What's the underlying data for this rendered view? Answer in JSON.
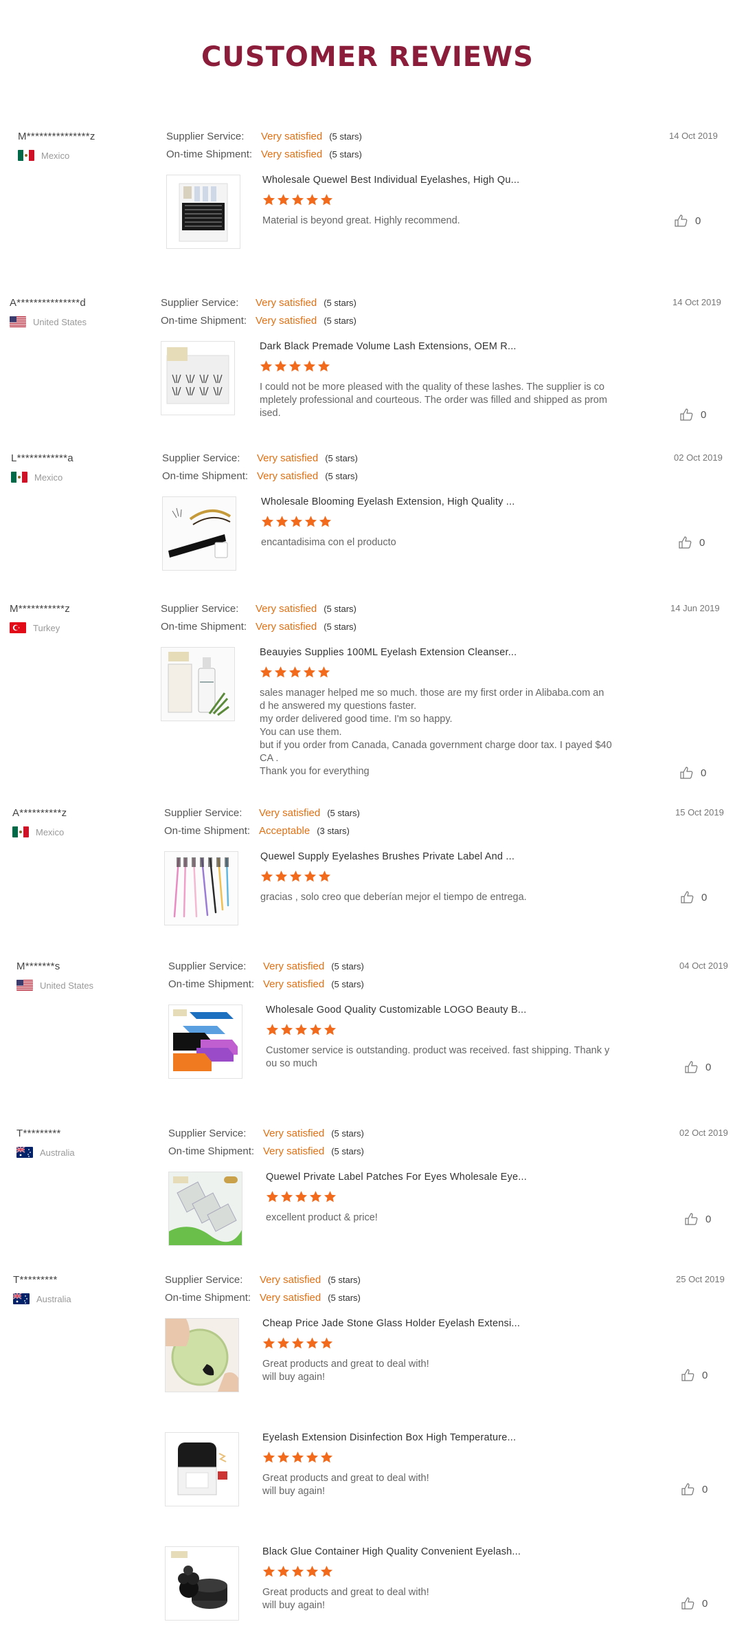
{
  "page_title": "CUSTOMER REVIEWS",
  "labels": {
    "supplier_service": "Supplier Service:",
    "ontime_shipment": "On-time Shipment:"
  },
  "reviews": [
    {
      "buyer": "M***************z",
      "country": "Mexico",
      "flag": "mexico-flag-icon",
      "supplier_rating": "Very satisfied",
      "supplier_stars": "(5 stars)",
      "shipment_rating": "Very satisfied",
      "shipment_stars": "(5 stars)",
      "date": "14 Oct 2019",
      "products": [
        {
          "title": "Wholesale Quewel Best Individual Eyelashes, High Qu...",
          "stars": 5,
          "comment": "Material is beyond great. Highly recommend.",
          "likes": "0",
          "thumb": "lash-trays-icon"
        }
      ]
    },
    {
      "buyer": "A***************d",
      "country": "United States",
      "flag": "usa-flag-icon",
      "supplier_rating": "Very satisfied",
      "supplier_stars": "(5 stars)",
      "shipment_rating": "Very satisfied",
      "shipment_stars": "(5 stars)",
      "date": "14 Oct 2019",
      "products": [
        {
          "title": "Dark Black Premade Volume Lash Extensions, OEM R...",
          "stars": 5,
          "comment": "I could not be more pleased with the quality of these lashes.  The supplier is co\nmpletely professional and courteous. The order was filled and shipped as prom\nised.",
          "likes": "0",
          "thumb": "premade-fans-icon"
        }
      ]
    },
    {
      "buyer": "L************a",
      "country": "Mexico",
      "flag": "mexico-flag-icon",
      "supplier_rating": "Very satisfied",
      "supplier_stars": "(5 stars)",
      "shipment_rating": "Very satisfied",
      "shipment_stars": "(5 stars)",
      "date": "02 Oct 2019",
      "products": [
        {
          "title": "Wholesale Blooming Eyelash Extension, High Quality ...",
          "stars": 5,
          "comment": "encantadisima con el producto",
          "likes": "0",
          "thumb": "blooming-lash-icon"
        }
      ]
    },
    {
      "buyer": "M***********z",
      "country": "Turkey",
      "flag": "turkey-flag-icon",
      "supplier_rating": "Very satisfied",
      "supplier_stars": "(5 stars)",
      "shipment_rating": "Very satisfied",
      "shipment_stars": "(5 stars)",
      "date": "14 Jun 2019",
      "products": [
        {
          "title": "Beauyies Supplies 100ML Eyelash Extension Cleanser...",
          "stars": 5,
          "comment": "sales manager helped me so much. those are my first order in Alibaba.com an\nd he answered my questions faster.\nmy order delivered good time. I'm so happy.\nYou can use  them.\nbut if you order from Canada, Canada government charge door tax. I payed $40\nCA .\nThank you for everything",
          "likes": "0",
          "thumb": "cleanser-bottle-icon"
        }
      ]
    },
    {
      "buyer": "A**********z",
      "country": "Mexico",
      "flag": "mexico-flag-icon",
      "supplier_rating": "Very satisfied",
      "supplier_stars": "(5 stars)",
      "shipment_rating": "Acceptable",
      "shipment_stars": "(3 stars)",
      "date": "15 Oct 2019",
      "products": [
        {
          "title": "Quewel Supply Eyelashes Brushes Private Label And ...",
          "stars": 5,
          "comment": "gracias , solo creo que deberían mejor el tiempo de entrega.",
          "likes": "0",
          "thumb": "brushes-icon"
        }
      ]
    },
    {
      "buyer": "M*******s",
      "country": "United States",
      "flag": "usa-flag-icon",
      "supplier_rating": "Very satisfied",
      "supplier_stars": "(5 stars)",
      "shipment_rating": "Very satisfied",
      "shipment_stars": "(5 stars)",
      "date": "04 Oct 2019",
      "products": [
        {
          "title": "Wholesale Good Quality Customizable LOGO Beauty B...",
          "stars": 5,
          "comment": "Customer service is outstanding. product was received. fast shipping. Thank y\nou so much",
          "likes": "0",
          "thumb": "bed-covers-icon"
        }
      ]
    },
    {
      "buyer": "T*********",
      "country": "Australia",
      "flag": "australia-flag-icon",
      "supplier_rating": "Very satisfied",
      "supplier_stars": "(5 stars)",
      "shipment_rating": "Very satisfied",
      "shipment_stars": "(5 stars)",
      "date": "02 Oct 2019",
      "products": [
        {
          "title": "Quewel Private Label Patches For Eyes Wholesale Eye...",
          "stars": 5,
          "comment": "excellent product & price!",
          "likes": "0",
          "thumb": "eye-patches-icon"
        }
      ]
    },
    {
      "buyer": "T*********",
      "country": "Australia",
      "flag": "australia-flag-icon",
      "supplier_rating": "Very satisfied",
      "supplier_stars": "(5 stars)",
      "shipment_rating": "Very satisfied",
      "shipment_stars": "(5 stars)",
      "date": "25 Oct 2019",
      "products": [
        {
          "title": "Cheap Price Jade Stone Glass Holder Eyelash Extensi...",
          "stars": 5,
          "comment": "Great products and great to deal with!\nwill buy again!",
          "likes": "0",
          "thumb": "jade-stone-icon"
        },
        {
          "title": "Eyelash Extension Disinfection Box High Temperature...",
          "stars": 5,
          "comment": "Great products and great to deal with!\nwill buy again!",
          "likes": "0",
          "thumb": "disinfection-box-icon"
        },
        {
          "title": "Black Glue Container High Quality Convenient Eyelash...",
          "stars": 5,
          "comment": "Great products and great to deal with!\nwill buy again!",
          "likes": "0",
          "thumb": "glue-container-icon"
        }
      ]
    }
  ]
}
